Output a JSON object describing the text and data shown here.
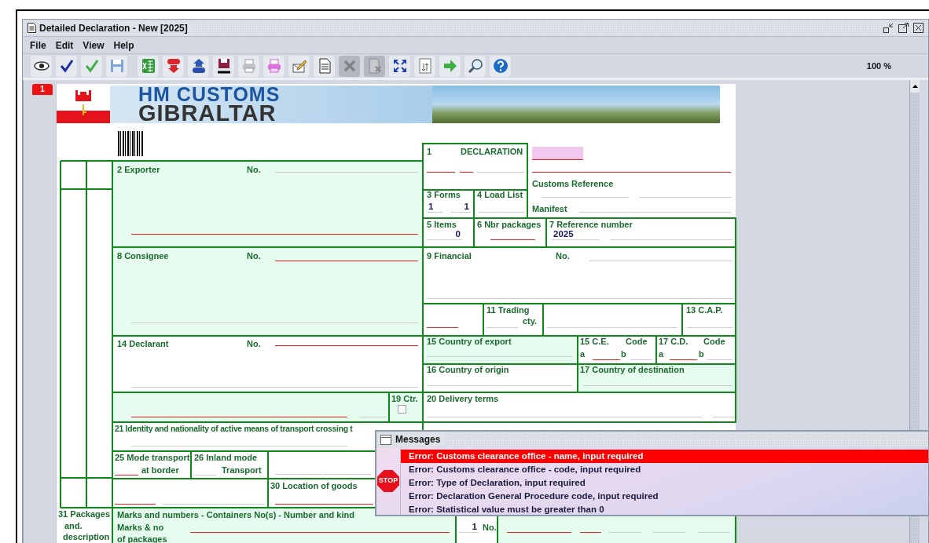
{
  "window": {
    "title": "Detailed Declaration - New [2025]"
  },
  "menu": [
    {
      "label": "File"
    },
    {
      "label": "Edit"
    },
    {
      "label": "View"
    },
    {
      "label": "Help"
    }
  ],
  "toolbar": {
    "buttons": [
      {
        "disabled": false
      },
      {
        "disabled": false
      },
      {
        "disabled": false
      },
      {
        "disabled": false
      },
      {
        "disabled": false
      },
      {
        "disabled": false
      },
      {
        "disabled": false
      },
      {
        "disabled": false
      },
      {
        "disabled": false
      },
      {
        "disabled": false
      },
      {
        "disabled": false
      },
      {
        "disabled": false
      },
      {
        "disabled": true
      },
      {
        "disabled": true
      },
      {
        "disabled": false
      },
      {
        "disabled": false
      },
      {
        "disabled": false
      },
      {
        "disabled": false
      },
      {
        "disabled": false
      }
    ],
    "zoom": "100 %"
  },
  "page_tab": "1",
  "banner": {
    "line_1": "HM CUSTOMS",
    "line_2": "GIBRALTAR"
  },
  "form": {
    "boxes": [
      {
        "labels": [
          "2 Exporter",
          "No."
        ],
        "fields": [
          {
            "required": false
          },
          {
            "required": true
          }
        ]
      },
      {
        "labels": [
          "1",
          "DECLARATION"
        ],
        "fields": [
          {
            "required": true
          },
          {
            "required": true
          },
          {
            "required": false
          }
        ]
      },
      {
        "labels": [
          "3 Forms"
        ],
        "fields": [
          {
            "required": false,
            "value": "1"
          },
          {
            "required": false,
            "value": "1"
          }
        ]
      },
      {
        "labels": [
          "4 Load List"
        ],
        "fields": [
          {
            "required": false
          }
        ]
      },
      {
        "labels": [
          "Customs Reference",
          "Manifest"
        ],
        "tinted_field": {
          "required": true
        },
        "fields": [
          {
            "required": true
          },
          {
            "required": false
          },
          {
            "required": false
          },
          {
            "required": false
          }
        ]
      },
      {
        "labels": [
          "5 Items"
        ],
        "fields": [
          {
            "required": false,
            "value": "0"
          }
        ]
      },
      {
        "labels": [
          "6 Nbr packages"
        ],
        "fields": [
          {
            "required": true
          }
        ]
      },
      {
        "labels": [
          "7 Reference number"
        ],
        "fields": [
          {
            "required": false,
            "value": "2025"
          },
          {
            "required": false
          }
        ]
      },
      {
        "labels": [
          "8 Consignee",
          "No."
        ],
        "fields": [
          {
            "required": true
          },
          {
            "required": false
          }
        ]
      },
      {
        "labels": [
          "9 Financial",
          "No."
        ],
        "fields": [
          {
            "required": false
          },
          {
            "required": false
          }
        ]
      },
      {
        "fields": [
          {
            "required": true
          }
        ]
      },
      {
        "labels": [
          "11 Trading",
          "cty."
        ],
        "fields": [
          {
            "required": false
          }
        ]
      },
      {
        "fields": [
          {
            "required": false
          }
        ]
      },
      {
        "labels": [
          "13 C.A.P."
        ],
        "fields": [
          {
            "required": false
          }
        ]
      },
      {
        "labels": [
          "14 Declarant",
          "No."
        ],
        "fields": [
          {
            "required": true
          },
          {
            "required": false
          }
        ]
      },
      {
        "labels": [
          "15 Country of export"
        ],
        "fields": [
          {
            "required": false
          }
        ]
      },
      {
        "labels": [
          "15 C.E.",
          "Code",
          "a",
          "b"
        ],
        "fields": [
          {
            "required": true
          },
          {
            "required": false
          }
        ]
      },
      {
        "labels": [
          "17 C.D.",
          "Code",
          "a",
          "b"
        ],
        "fields": [
          {
            "required": true
          },
          {
            "required": false
          }
        ]
      },
      {
        "labels": [
          "16 Country of origin"
        ],
        "fields": [
          {
            "required": false
          }
        ]
      },
      {
        "labels": [
          "17 Country of destination"
        ],
        "fields": [
          {
            "required": false
          }
        ]
      },
      {
        "fields": [
          {
            "required": true
          },
          {
            "required": false
          }
        ]
      },
      {
        "labels": [
          "19 Ctr."
        ],
        "checkbox": {
          "checked": false
        }
      },
      {
        "labels": [
          "20 Delivery terms"
        ],
        "fields": [
          {
            "required": false
          },
          {
            "required": false
          }
        ]
      },
      {
        "labels": [
          "21 Identity and nationality of active means of transport crossing t"
        ],
        "fields": [
          {
            "required": false
          }
        ]
      },
      {
        "labels": [
          "25 Mode transport",
          "at border"
        ],
        "fields": [
          {
            "required": true
          }
        ]
      },
      {
        "labels": [
          "26 Inland mode",
          "Transport"
        ],
        "fields": [
          {
            "required": false
          }
        ]
      },
      {
        "fields": [
          {
            "required": false
          },
          {
            "required": false
          }
        ]
      },
      {
        "fields": [
          {
            "required": true
          },
          {
            "required": false
          }
        ]
      },
      {
        "labels": [
          "30 Location of goods"
        ],
        "fields": [
          {
            "required": true
          }
        ]
      },
      {
        "labels": [
          "31 Packages",
          "and.",
          "description"
        ]
      },
      {
        "labels": [
          "Marks and numbers - Containers No(s) - Number and kind",
          "Marks & no",
          "of packages"
        ],
        "fields": [
          {
            "required": true
          }
        ]
      },
      {
        "labels": [
          "No."
        ],
        "fields": [
          {
            "required": false,
            "value": "1"
          }
        ]
      },
      {
        "fields": [
          {
            "required": true
          },
          {
            "required": true
          },
          {
            "required": false
          },
          {
            "required": false
          },
          {
            "required": false
          }
        ]
      }
    ]
  },
  "messages": {
    "title": "Messages",
    "stop_label": "STOP",
    "items": [
      {
        "text": "Error: Customs clearance office - name, input required",
        "selected": true
      },
      {
        "text": "Error: Customs clearance office - code, input required",
        "selected": false
      },
      {
        "text": "Error: Type of Declaration, input required",
        "selected": false
      },
      {
        "text": "Error: Declaration General Procedure code, input required",
        "selected": false
      },
      {
        "text": "Error: Statistical value must be greater than 0",
        "selected": false
      }
    ]
  }
}
